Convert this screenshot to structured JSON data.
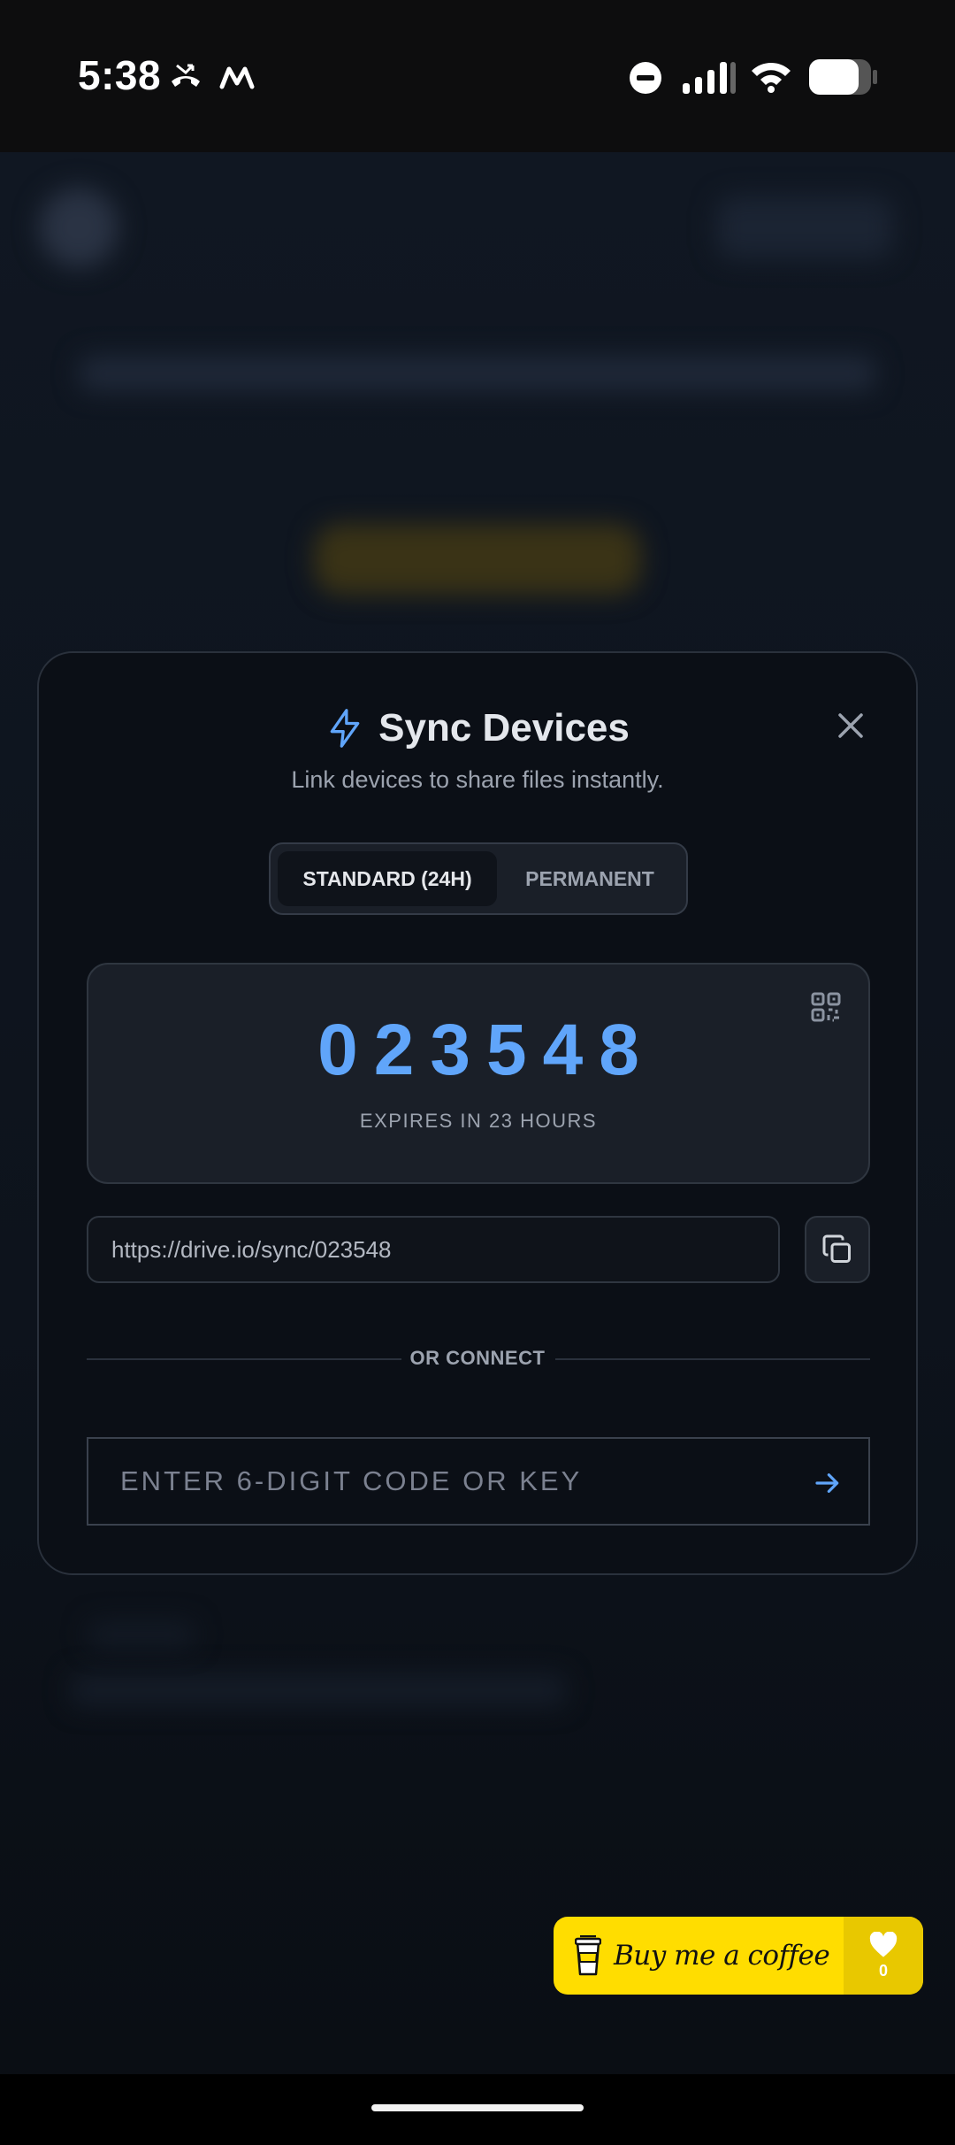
{
  "status_bar": {
    "time": "5:38",
    "icons": [
      "missed-call-icon",
      "app-m-icon",
      "do-not-disturb-icon",
      "signal-icon",
      "wifi-icon",
      "battery-icon"
    ]
  },
  "modal": {
    "title": "Sync Devices",
    "title_icon": "lightning-icon",
    "subtitle": "Link devices to share files instantly.",
    "close_icon": "close-icon",
    "tabs": [
      {
        "label": "STANDARD (24H)",
        "active": true
      },
      {
        "label": "PERMANENT",
        "active": false
      }
    ],
    "code": {
      "value": "023548",
      "expiry": "EXPIRES IN 23 HOURS",
      "qr_icon": "qr-code-icon"
    },
    "link": {
      "url": "https://drive.io/sync/023548",
      "copy_icon": "copy-icon"
    },
    "divider_label": "OR CONNECT",
    "connect": {
      "placeholder": "ENTER 6-DIGIT CODE OR KEY",
      "submit_icon": "arrow-right-icon"
    }
  },
  "coffee_button": {
    "label": "Buy me a coffee",
    "count": "0",
    "cup_icon": "coffee-cup-icon",
    "heart_icon": "heart-icon"
  },
  "colors": {
    "accent": "#60a5fa",
    "modal_bg": "#0b0f16",
    "card_bg": "#1a1f28",
    "coffee_yellow": "#ffdd00"
  }
}
